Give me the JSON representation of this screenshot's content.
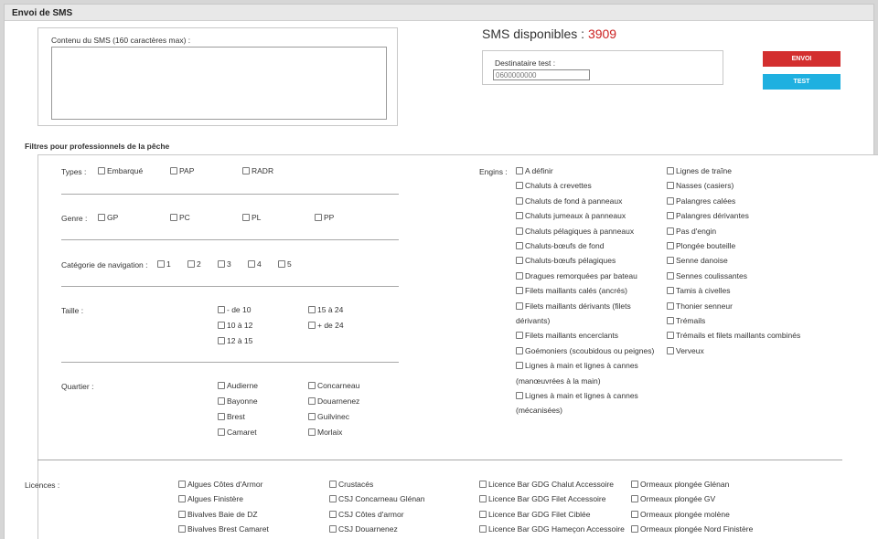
{
  "header": {
    "title": "Envoi de SMS"
  },
  "sms": {
    "label": "Contenu du SMS (160 caractères max) :",
    "value": ""
  },
  "available": {
    "label": "SMS disponibles : ",
    "count": "3909"
  },
  "test": {
    "label": "Destinataire test :",
    "placeholder": "0600000000"
  },
  "buttons": {
    "send": "ENVOI",
    "test": "TEST",
    "send_color": "#d32f2f",
    "test_color": "#1fb0e0"
  },
  "filters": {
    "title": "Filtres pour professionnels de la pêche",
    "types": {
      "label": "Types :",
      "options": [
        "Embarqué",
        "PAP",
        "RADR"
      ]
    },
    "genre": {
      "label": "Genre :",
      "options": [
        "GP",
        "PC",
        "PL",
        "PP"
      ]
    },
    "navigation": {
      "label": "Catégorie de navigation :",
      "options": [
        "1",
        "2",
        "3",
        "4",
        "5"
      ]
    },
    "taille": {
      "label": "Taille :",
      "col1": [
        "- de 10",
        "10 à 12",
        "12 à 15"
      ],
      "col2": [
        "15 à 24",
        "+ de 24"
      ]
    },
    "quartier": {
      "label": "Quartier :",
      "col1": [
        "Audierne",
        "Bayonne",
        "Brest",
        "Camaret"
      ],
      "col2": [
        "Concarneau",
        "Douarnenez",
        "Guilvinec",
        "Morlaix"
      ]
    },
    "engins": {
      "label": "Engins :",
      "col1": [
        {
          "text": "A définir"
        },
        {
          "text": "Chaluts à crevettes"
        },
        {
          "text": "Chaluts de fond à panneaux"
        },
        {
          "text": "Chaluts jumeaux à panneaux"
        },
        {
          "text": "Chaluts pélagiques à panneaux"
        },
        {
          "text": "Chaluts-bœufs de fond"
        },
        {
          "text": "Chaluts-bœufs pélagiques"
        },
        {
          "text": "Dragues remorquées par bateau"
        },
        {
          "text": "Filets maillants calés (ancrés)"
        },
        {
          "text": "Filets maillants dérivants (filets",
          "cont": "dérivants)"
        },
        {
          "text": "Filets maillants encerclants"
        },
        {
          "text": "Goémoniers (scoubidous ou peignes)"
        },
        {
          "text": "Lignes à main et lignes à cannes",
          "cont": "(manœuvrées à la main)"
        },
        {
          "text": "Lignes à main et lignes à cannes",
          "cont": "(mécanisées)"
        }
      ],
      "col2": [
        "Lignes de traîne",
        "Nasses (casiers)",
        "Palangres calées",
        "Palangres dérivantes",
        "Pas d'engin",
        "Plongée bouteille",
        "Senne danoise",
        "Sennes coulissantes",
        "Tamis à civelles",
        "Thonier senneur",
        "Trémails",
        "Trémails et filets maillants combinés",
        "Verveux"
      ]
    }
  },
  "licences": {
    "label": "Licences :",
    "col1": [
      "Algues Côtes d'Armor",
      "Algues Finistère",
      "Bivalves Baie de DZ",
      "Bivalves Brest Camaret"
    ],
    "col2": [
      "Crustacés",
      "CSJ Concarneau Glénan",
      "CSJ Côtes d'armor",
      "CSJ Douarnenez"
    ],
    "col3": [
      "Licence Bar GDG Chalut Accessoire",
      "Licence Bar GDG Filet Accessoire",
      "Licence Bar GDG Filet Ciblée",
      "Licence Bar GDG Hameçon Accessoire"
    ],
    "col4": [
      "Ormeaux plongée Glénan",
      "Ormeaux plongée GV",
      "Ormeaux plongée molène",
      "Ormeaux plongée Nord Finistère"
    ]
  }
}
